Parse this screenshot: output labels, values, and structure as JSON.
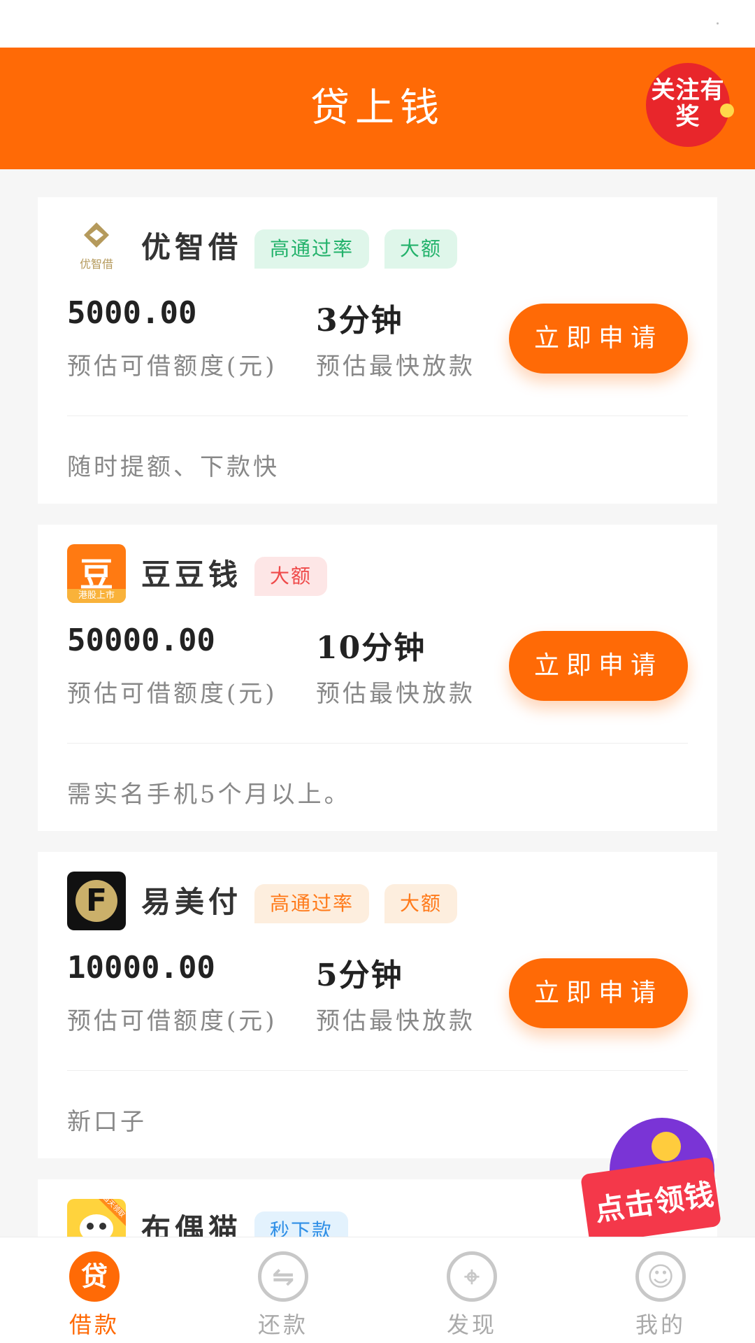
{
  "header": {
    "title": "贷上钱",
    "promo_badge_text": "关注有奖"
  },
  "labels": {
    "amount_label": "预估可借额度(元)",
    "time_label": "预估最快放款",
    "apply_button": "立即申请"
  },
  "loans": [
    {
      "name": "优智借",
      "logo_text": "优智借",
      "logo_icon": "diamond-logo-icon",
      "tags": [
        {
          "label": "高通过率",
          "color": "green"
        },
        {
          "label": "大额",
          "color": "green"
        }
      ],
      "amount": "5000.00",
      "time": "3分钟",
      "description": "随时提额、下款快"
    },
    {
      "name": "豆豆钱",
      "logo_text": "豆",
      "logo_sub": "港股上市",
      "tags": [
        {
          "label": "大额",
          "color": "red"
        }
      ],
      "amount": "50000.00",
      "time": "10分钟",
      "description": "需实名手机5个月以上。"
    },
    {
      "name": "易美付",
      "logo_text": "F",
      "tags": [
        {
          "label": "高通过率",
          "color": "orange"
        },
        {
          "label": "大额",
          "color": "orange"
        }
      ],
      "amount": "10000.00",
      "time": "5分钟",
      "description": "新口子"
    },
    {
      "name": "布偶猫",
      "logo_text": "当天领取",
      "tags": [
        {
          "label": "秒下款",
          "color": "blue"
        }
      ]
    }
  ],
  "floating_promo": {
    "label": "点击领钱"
  },
  "tabbar": {
    "items": [
      {
        "label": "借款",
        "icon": "loan-icon",
        "glyph": "贷",
        "active": true
      },
      {
        "label": "还款",
        "icon": "repay-icon",
        "glyph": "⇋",
        "active": false
      },
      {
        "label": "发现",
        "icon": "compass-icon",
        "glyph": "⌖",
        "active": false
      },
      {
        "label": "我的",
        "icon": "user-icon",
        "glyph": "☺",
        "active": false
      }
    ]
  },
  "colors": {
    "accent": "#ff6a06",
    "header_bg": "#ff6a06",
    "page_bg": "#f6f6f6"
  }
}
